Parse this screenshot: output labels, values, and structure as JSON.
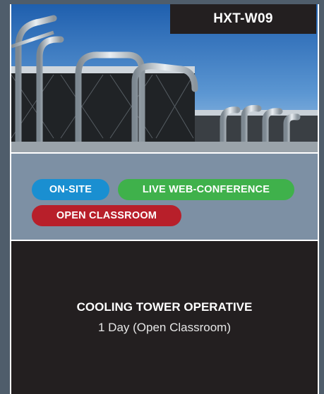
{
  "course": {
    "code": "HXT-W09",
    "title": "COOLING TOWER OPERATIVE",
    "duration": "1 Day (Open Classroom)"
  },
  "hero_image": {
    "description_icon": "cooling-tower-photo"
  },
  "delivery_tags": [
    {
      "label": "ON-SITE",
      "color": "#1a8fd1"
    },
    {
      "label": "LIVE WEB-CONFERENCE",
      "color": "#3fb14b"
    },
    {
      "label": "OPEN CLASSROOM",
      "color": "#b81f2a"
    }
  ],
  "colors": {
    "page_bg": "#4f5d6b",
    "tag_panel": "#7d90a4",
    "dark": "#231f20"
  }
}
